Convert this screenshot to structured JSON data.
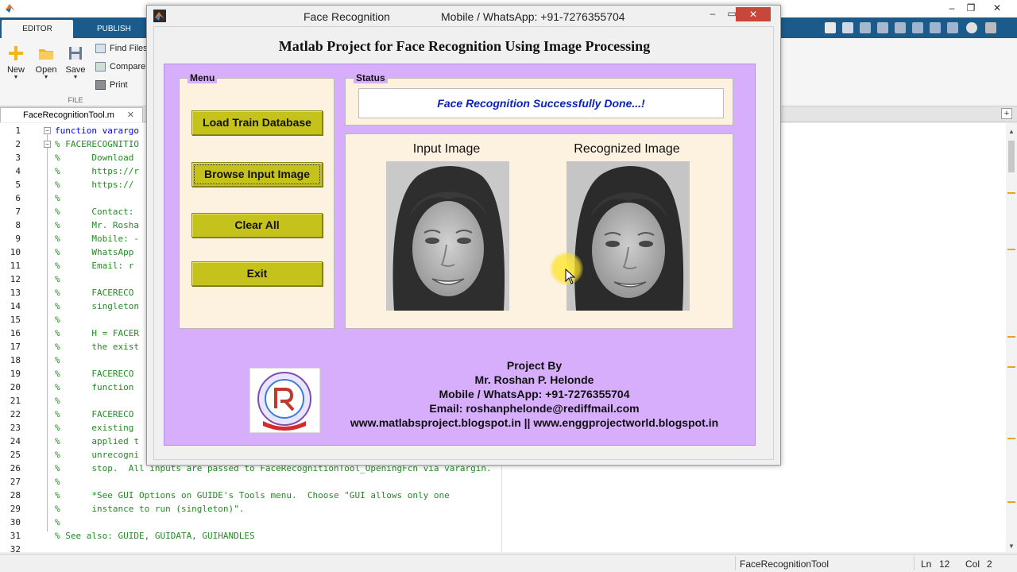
{
  "matlab": {
    "ribbon_tabs": [
      "EDITOR",
      "PUBLISH"
    ],
    "buttons": {
      "new": "New",
      "open": "Open",
      "save": "Save"
    },
    "small_buttons": [
      "Find Files",
      "Compare",
      "Print"
    ],
    "group_file": "FILE",
    "editor_tab": "FaceRecognitionTool.m",
    "editor_tab_close": "✕",
    "add_tab": "+",
    "code_lines": [
      {
        "n": "1",
        "text": "function varargo",
        "kw": true
      },
      {
        "n": "2",
        "text": "% FACERECOGNITIO",
        "kw": false
      },
      {
        "n": "3",
        "text": "%      Download",
        "kw": false
      },
      {
        "n": "4",
        "text": "%      https://r",
        "kw": false
      },
      {
        "n": "5",
        "text": "%      https://",
        "kw": false
      },
      {
        "n": "6",
        "text": "%",
        "kw": false
      },
      {
        "n": "7",
        "text": "%      Contact:",
        "kw": false
      },
      {
        "n": "8",
        "text": "%      Mr. Rosha",
        "kw": false
      },
      {
        "n": "9",
        "text": "%      Mobile: -",
        "kw": false
      },
      {
        "n": "10",
        "text": "%      WhatsApp",
        "kw": false
      },
      {
        "n": "11",
        "text": "%      Email: r",
        "kw": false
      },
      {
        "n": "12",
        "text": "%",
        "kw": false
      },
      {
        "n": "13",
        "text": "%      FACERECO",
        "kw": false
      },
      {
        "n": "14",
        "text": "%      singleton",
        "kw": false
      },
      {
        "n": "15",
        "text": "%",
        "kw": false
      },
      {
        "n": "16",
        "text": "%      H = FACER",
        "kw": false
      },
      {
        "n": "17",
        "text": "%      the exist",
        "kw": false
      },
      {
        "n": "18",
        "text": "%",
        "kw": false
      },
      {
        "n": "19",
        "text": "%      FACERECO",
        "kw": false
      },
      {
        "n": "20",
        "text": "%      function",
        "kw": false
      },
      {
        "n": "21",
        "text": "%",
        "kw": false
      },
      {
        "n": "22",
        "text": "%      FACERECO",
        "kw": false
      },
      {
        "n": "23",
        "text": "%      existing",
        "kw": false
      },
      {
        "n": "24",
        "text": "%      applied t",
        "kw": false
      },
      {
        "n": "25",
        "text": "%      unrecogni",
        "kw": false
      },
      {
        "n": "26",
        "text": "%      stop.  All inputs are passed to FaceRecognitionTool_OpeningFcn via varargin.",
        "kw": false
      },
      {
        "n": "27",
        "text": "%",
        "kw": false
      },
      {
        "n": "28",
        "text": "%      *See GUI Options on GUIDE's Tools menu.  Choose \"GUI allows only one",
        "kw": false
      },
      {
        "n": "29",
        "text": "%      instance to run (singleton)\".",
        "kw": false
      },
      {
        "n": "30",
        "text": "%",
        "kw": false
      },
      {
        "n": "31",
        "text": "% See also: GUIDE, GUIDATA, GUIHANDLES",
        "kw": false
      },
      {
        "n": "32",
        "text": "",
        "kw": false
      }
    ],
    "status": {
      "file": "FaceRecognitionTool",
      "ln_label": "Ln",
      "ln": "12",
      "col_label": "Col",
      "col": "2"
    }
  },
  "fig": {
    "title": "Face Recognition",
    "phone_title": "Mobile / WhatsApp: +91-7276355704",
    "heading": "Matlab Project for Face Recognition Using Image Processing",
    "menu_label": "Menu",
    "status_label": "Status",
    "buttons": {
      "load": "Load Train Database",
      "browse": "Browse Input Image",
      "clear": "Clear All",
      "exit": "Exit"
    },
    "status_text": "Face Recognition Successfully Done...!",
    "input_caption": "Input Image",
    "recognized_caption": "Recognized Image",
    "credits": [
      "Project By",
      "Mr. Roshan P. Helonde",
      "Mobile / WhatsApp: +91-7276355704",
      "Email: roshanphelonde@rediffmail.com",
      "www.matlabsproject.blogspot.in ||  www.enggprojectworld.blogspot.in"
    ]
  },
  "colors": {
    "purple_panel": "#d6aefc",
    "cream_panel": "#fdf1e0",
    "button": "#c6c21c",
    "status_text": "#0d23b8",
    "ribbon": "#1a5b8c"
  },
  "icons": [
    "matlab-logo-icon",
    "new-file-icon",
    "open-folder-icon",
    "save-icon",
    "find-files-icon",
    "compare-icon",
    "print-icon",
    "close-icon",
    "minimize-icon",
    "maximize-icon",
    "mouse-cursor-icon",
    "college-logo-icon"
  ]
}
